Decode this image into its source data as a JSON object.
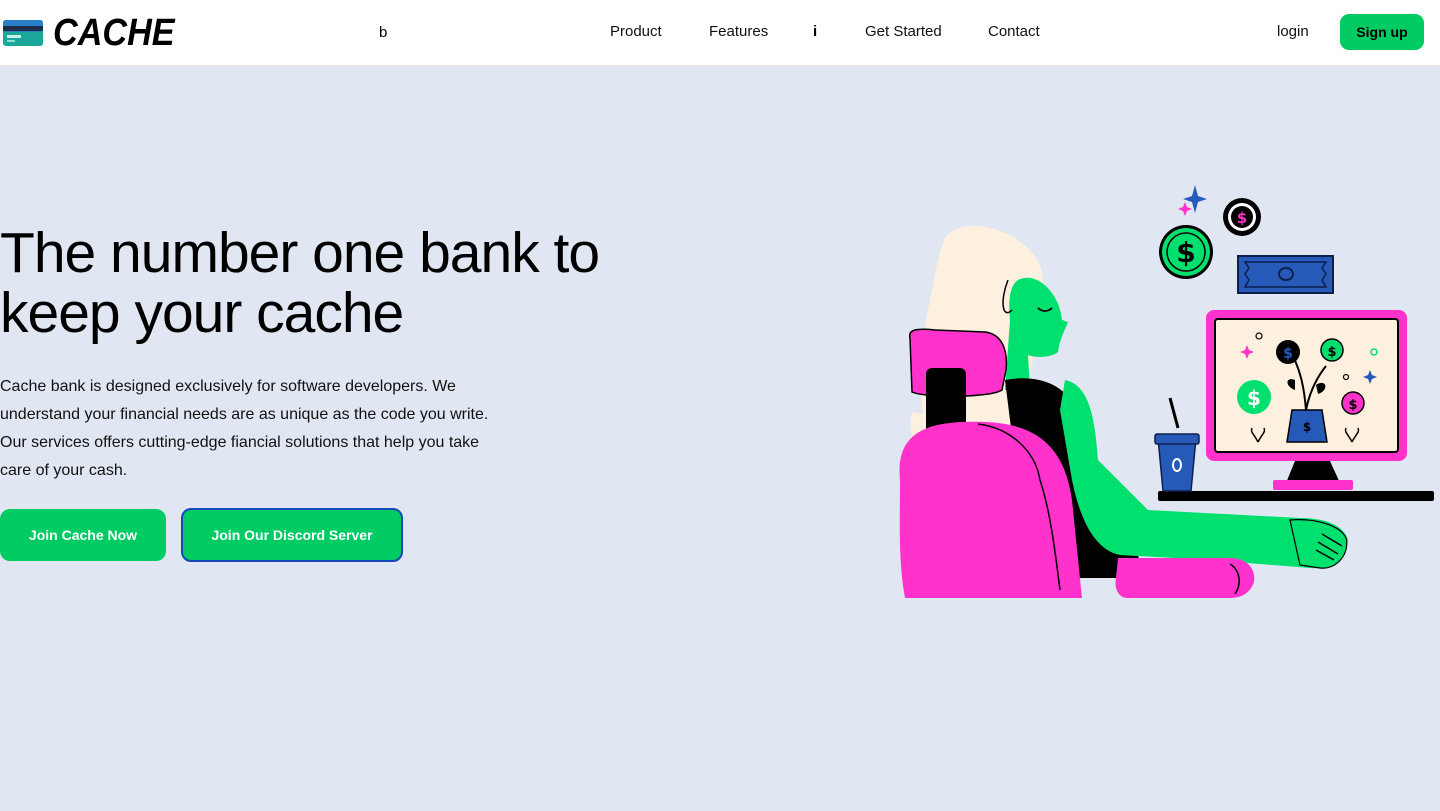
{
  "brand": {
    "name": "CACHE",
    "logo_icon": "credit-card-icon"
  },
  "nav": {
    "stray_b": "b",
    "stray_i": "i",
    "links": [
      "Product",
      "Features",
      "Get Started",
      "Contact"
    ],
    "login_label": "login",
    "signup_label": "Sign up"
  },
  "hero": {
    "title": "The number one bank to keep your cache",
    "description": "Cache bank is designed exclusively for software developers. We understand your financial needs are as unique as the code you write. Our services offers cutting-edge fiancial solutions that help you take care of your cash.",
    "primary_cta": "Join Cache Now",
    "secondary_cta": "Join Our Discord Server",
    "illustration": "woman-at-computer-with-coins-illustration"
  },
  "colors": {
    "accent": "#00cc63",
    "background": "#e1e7f2",
    "pink": "#ff33cc",
    "blue": "#2659b8",
    "button_border": "#1747b8"
  }
}
